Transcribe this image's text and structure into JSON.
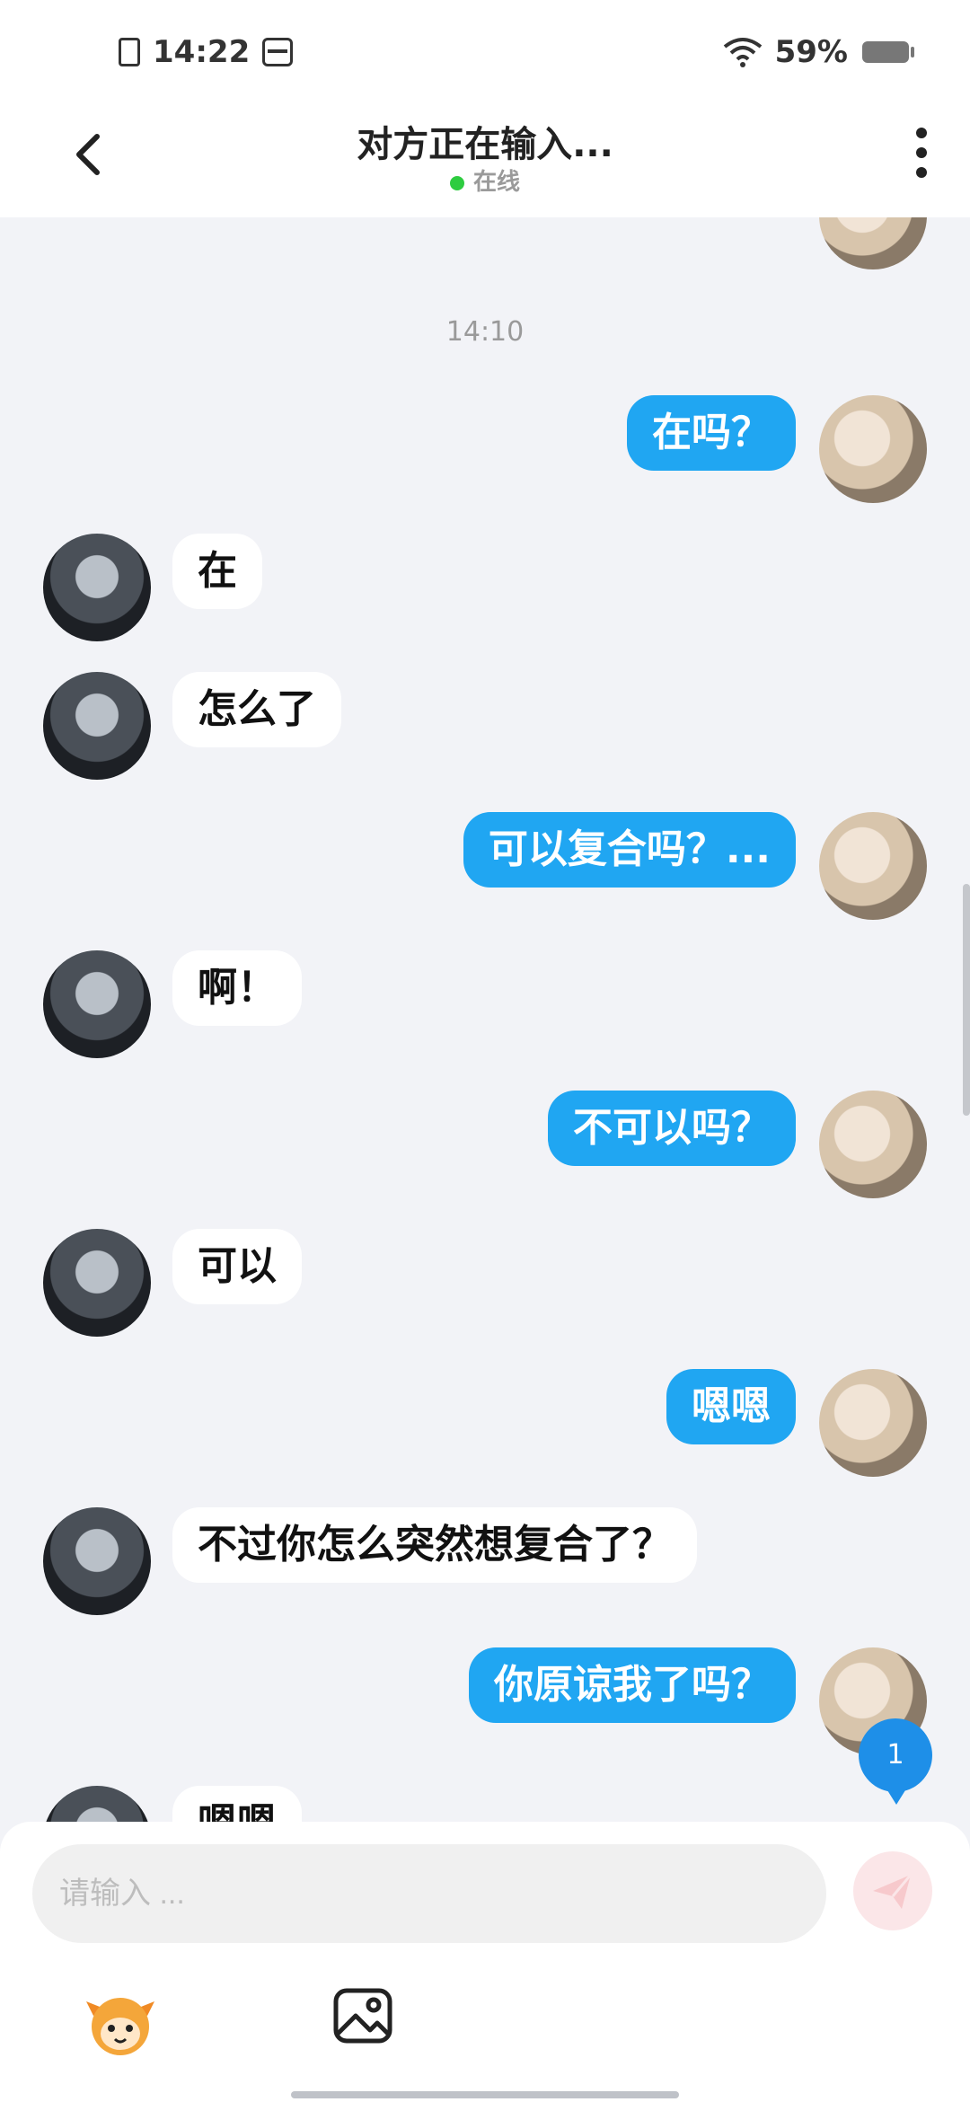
{
  "status_bar": {
    "time": "14:22",
    "battery": "59%"
  },
  "header": {
    "title": "对方正在输入...",
    "status": "在线"
  },
  "chat": {
    "timestamp": "14:10",
    "messages": [
      {
        "from": "me",
        "text": "在吗？"
      },
      {
        "from": "other",
        "text": "在"
      },
      {
        "from": "other",
        "text": "怎么了"
      },
      {
        "from": "me",
        "text": "可以复合吗？..."
      },
      {
        "from": "other",
        "text": "啊！"
      },
      {
        "from": "me",
        "text": "不可以吗？"
      },
      {
        "from": "other",
        "text": "可以"
      },
      {
        "from": "me",
        "text": "嗯嗯"
      },
      {
        "from": "other",
        "text": "不过你怎么突然想复合了？"
      },
      {
        "from": "me",
        "text": "你原谅我了吗？"
      },
      {
        "from": "other",
        "text": "嗯嗯"
      }
    ],
    "unread_count": "1"
  },
  "composer": {
    "placeholder": "请输入 ..."
  },
  "colors": {
    "my_bubble": "#20a6f2",
    "other_bubble": "#ffffff",
    "background": "#f2f3f7",
    "online": "#2ecc40",
    "badge": "#1e8fe8"
  },
  "icons": {
    "back": "chevron-left-icon",
    "more": "more-vertical-icon",
    "send": "send-icon",
    "emoji": "mascot-emoji-icon",
    "image": "image-icon"
  }
}
